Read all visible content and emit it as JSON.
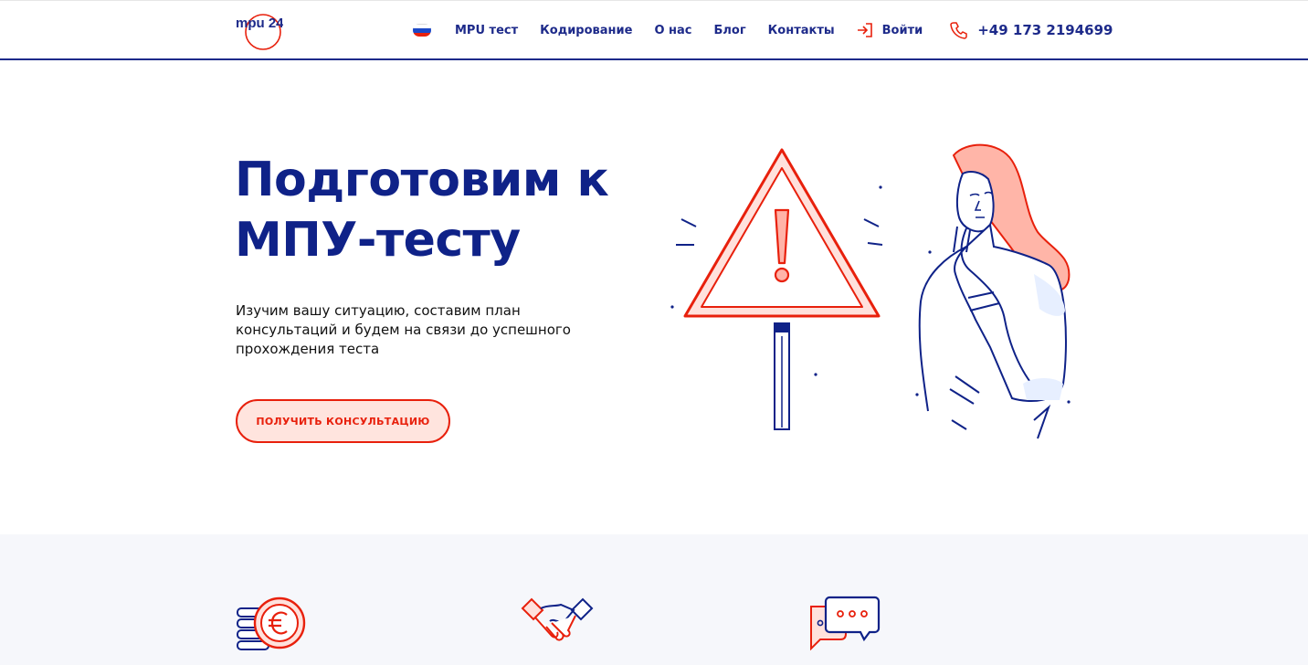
{
  "header": {
    "logo_text": "mpu 24/7",
    "nav": [
      {
        "label": "MPU тест"
      },
      {
        "label": "Кодирование"
      },
      {
        "label": "О нас"
      },
      {
        "label": "Блог"
      },
      {
        "label": "Контакты"
      }
    ],
    "login_label": "Войти",
    "phone": "+49 173 2194699"
  },
  "hero": {
    "title_line1": "Подготовим к",
    "title_line2": "МПУ-тесту",
    "text": "Изучим вашу ситуацию, составим план консультаций и будем на связи до успешного прохождения теста",
    "cta_label": "ПОЛУЧИТЬ КОНСУЛЬТАЦИЮ"
  },
  "colors": {
    "brand_blue": "#0f2288",
    "accent_red": "#e8200c",
    "accent_light": "#ffe4de"
  },
  "icons": [
    "ru-flag-icon",
    "login-icon",
    "phone-icon",
    "euro-coins-icon",
    "handshake-icon",
    "chat-bubbles-icon"
  ]
}
